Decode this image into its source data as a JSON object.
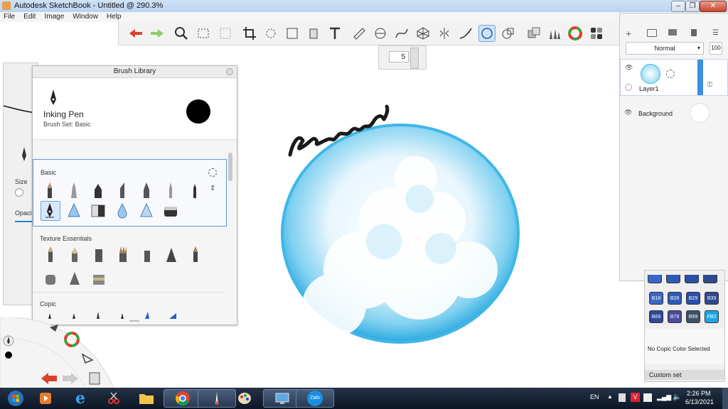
{
  "window": {
    "title": "Autodesk SketchBook - Untitled @ 290.3%",
    "btn_min": "–",
    "btn_max": "❐",
    "btn_close": "✕"
  },
  "menu": [
    "File",
    "Edit",
    "Image",
    "Window",
    "Help"
  ],
  "toolbar": {
    "tools": [
      "undo-icon",
      "redo-icon",
      "zoom-icon",
      "select-rect-icon",
      "select-lasso-icon",
      "crop-icon",
      "transform-icon",
      "distort-icon",
      "fill-icon",
      "text-icon",
      "ruler-icon",
      "ellipse-icon",
      "curve-icon",
      "perspective-icon",
      "symmetry-icon",
      "stroke-icon",
      "predictive-stroke-icon",
      "copic-icon",
      "layer-icon",
      "brush-icon",
      "color-wheel-icon",
      "swatches-icon"
    ]
  },
  "brush_size_value": "5",
  "brush_library": {
    "title": "Brush Library",
    "brush_name": "Inking Pen",
    "brush_set": "Brush Set: Basic",
    "section_basic": "Basic",
    "section_texture": "Texture Essentials",
    "section_copic": "Copic"
  },
  "left_panel": {
    "size_label": "Size",
    "opacity_label": "Opacit"
  },
  "canvas": {
    "handwriting": "elanu",
    "bubble_color": "#3fb7e6"
  },
  "layers": {
    "blend_mode": "Normal",
    "opacity": "100",
    "layer1_name": "Layer1",
    "background_name": "Background"
  },
  "copic": {
    "swatches": [
      {
        "label": "B18",
        "color": "#3b66c4"
      },
      {
        "label": "B28",
        "color": "#2f5bb7"
      },
      {
        "label": "B29",
        "color": "#2a4fa8"
      },
      {
        "label": "B39",
        "color": "#2d4a8f"
      },
      {
        "label": "B69",
        "color": "#30479c"
      },
      {
        "label": "B79",
        "color": "#4a4a9e"
      },
      {
        "label": "B99",
        "color": "#3d5268"
      },
      {
        "label": "FB2",
        "color": "#1aa6e8"
      }
    ],
    "no_color_text": "No Copic Color Selected",
    "custom_set": "Custom set"
  },
  "taskbar": {
    "lang": "EN",
    "time": "2:26 PM",
    "date": "6/13/2021",
    "apps": [
      "windows-start-icon",
      "media-player-icon",
      "internet-explorer-icon",
      "snipping-tool-icon",
      "file-explorer-icon",
      "chrome-icon",
      "sketchbook-icon",
      "paint-icon",
      "remote-desktop-icon",
      "zalo-icon"
    ],
    "zalo_label": "Zalo"
  }
}
